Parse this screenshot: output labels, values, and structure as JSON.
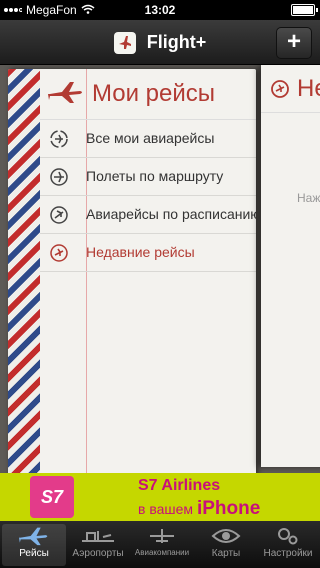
{
  "status_bar": {
    "carrier": "MegaFon",
    "time": "13:02"
  },
  "nav": {
    "title": "Flight+",
    "add_label": "+"
  },
  "main_card": {
    "title": "Мои рейсы",
    "items": [
      {
        "label": "Все мои авиарейсы",
        "icon": "refresh-plane-icon"
      },
      {
        "label": "Полеты по маршруту",
        "icon": "plane-circle-icon"
      },
      {
        "label": "Авиарейсы по расписанию",
        "icon": "plane-circle-icon"
      },
      {
        "label": "Недавние рейсы",
        "icon": "clock-icon"
      }
    ],
    "active_index": 3
  },
  "side_card": {
    "title": "Не",
    "hint": "Наж"
  },
  "ad": {
    "logo": "S7",
    "line1": "S7 Airlines",
    "line2_prefix": "в вашем",
    "line2_brand": "iPhone"
  },
  "tabs": [
    {
      "label": "Рейсы",
      "icon": "plane-icon"
    },
    {
      "label": "Аэропорты",
      "icon": "airport-icon"
    },
    {
      "label": "Авиакомпании",
      "icon": "airline-icon"
    },
    {
      "label": "Карты",
      "icon": "map-icon"
    },
    {
      "label": "Настройки",
      "icon": "gear-icon"
    }
  ],
  "active_tab": 0,
  "colors": {
    "accent_red": "#b23b33",
    "ad_bg": "#c5d700",
    "ad_text": "#c8107a"
  }
}
